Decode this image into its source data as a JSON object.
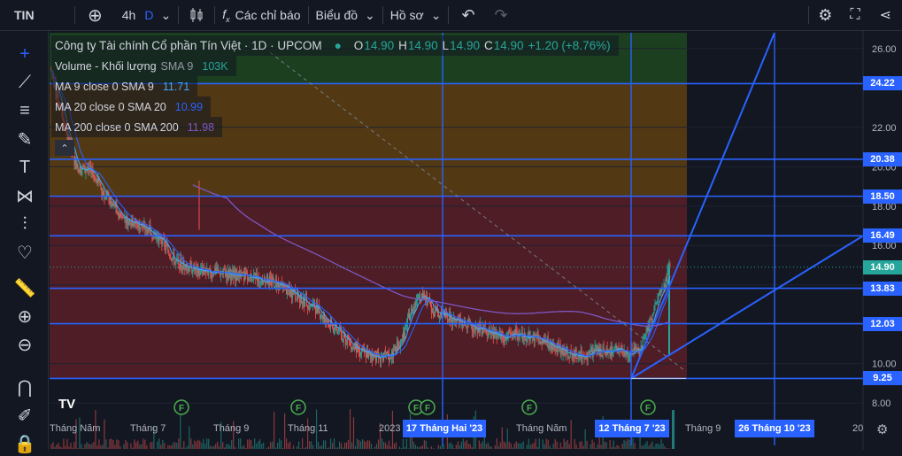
{
  "topbar": {
    "ticker": "TIN",
    "interval": "4h",
    "chart_style": "D",
    "indicators_label": "Các chỉ báo",
    "layout_label": "Biểu đồ",
    "profile_label": "Hồ sơ"
  },
  "legend": {
    "title": "Công ty Tài chính Cổ phần Tín Việt · 1D · UPCOM",
    "ohlc": {
      "o_label": "O",
      "o": "14.90",
      "h_label": "H",
      "h": "14.90",
      "l_label": "L",
      "l": "14.90",
      "c_label": "C",
      "c": "14.90",
      "change": "+1.20 (+8.76%)"
    },
    "volume": {
      "label": "Volume - Khối lượng",
      "params": "SMA 9",
      "value": "103K"
    },
    "ma9": {
      "label": "MA 9 close 0 SMA 9",
      "value": "11.71"
    },
    "ma20": {
      "label": "MA 20 close 0 SMA 20",
      "value": "10.99"
    },
    "ma200": {
      "label": "MA 200 close 0 SMA 200",
      "value": "11.98"
    }
  },
  "colors": {
    "background": "#131722",
    "up": "#26a69a",
    "down": "#ef5350",
    "ma9": "#42a5f5",
    "ma20": "#2962ff",
    "ma200": "#7e57c2",
    "level_line": "#2962ff",
    "zone_green": "#1e4620",
    "zone_orange": "#5a3d12",
    "zone_red": "#5a1f27"
  },
  "chart_data": {
    "type": "candlestick",
    "y_range": [
      7.2,
      26.8
    ],
    "y_ticks": [
      "26.00",
      "22.00",
      "20.00",
      "18.00",
      "16.00",
      "14.00",
      "12.00",
      "10.00",
      "8.00"
    ],
    "price_levels": [
      {
        "label": "24.22",
        "value": 24.22
      },
      {
        "label": "20.38",
        "value": 20.38
      },
      {
        "label": "18.50",
        "value": 18.5
      },
      {
        "label": "16.49",
        "value": 16.49
      },
      {
        "label": "13.83",
        "value": 13.83
      },
      {
        "label": "12.03",
        "value": 12.03
      },
      {
        "label": "9.25",
        "value": 9.25
      }
    ],
    "last_price": "14.90",
    "x_labels": [
      "Tháng Năm",
      "Tháng 7",
      "Tháng 9",
      "Tháng 11",
      "2023",
      "Tháng Năm",
      "Tháng 9",
      "20"
    ],
    "x_highlights": [
      "17 Tháng Hai '23",
      "12 Tháng 7 '23",
      "26 Tháng 10 '23"
    ],
    "price_path": [
      [
        0,
        24.9
      ],
      [
        18,
        21.6
      ],
      [
        30,
        19.8
      ],
      [
        45,
        19.9
      ],
      [
        60,
        18.6
      ],
      [
        80,
        17.4
      ],
      [
        95,
        17.2
      ],
      [
        110,
        16.8
      ],
      [
        125,
        16.2
      ],
      [
        140,
        15.2
      ],
      [
        160,
        14.8
      ],
      [
        185,
        14.6
      ],
      [
        210,
        14.5
      ],
      [
        235,
        14.3
      ],
      [
        255,
        14.1
      ],
      [
        275,
        13.5
      ],
      [
        300,
        12.8
      ],
      [
        320,
        11.8
      ],
      [
        335,
        11.2
      ],
      [
        350,
        10.6
      ],
      [
        365,
        10.4
      ],
      [
        380,
        10.3
      ],
      [
        395,
        11.0
      ],
      [
        405,
        12.4
      ],
      [
        415,
        13.6
      ],
      [
        425,
        13.2
      ],
      [
        435,
        12.6
      ],
      [
        450,
        12.3
      ],
      [
        465,
        12.0
      ],
      [
        480,
        11.9
      ],
      [
        495,
        11.6
      ],
      [
        510,
        11.3
      ],
      [
        525,
        11.5
      ],
      [
        540,
        11.4
      ],
      [
        555,
        11.2
      ],
      [
        570,
        10.9
      ],
      [
        585,
        10.5
      ],
      [
        600,
        10.4
      ],
      [
        615,
        10.7
      ],
      [
        625,
        10.6
      ],
      [
        640,
        10.7
      ],
      [
        655,
        10.5
      ],
      [
        665,
        10.6
      ],
      [
        675,
        11.8
      ],
      [
        690,
        13.7
      ],
      [
        700,
        14.9
      ]
    ],
    "events": [
      "F",
      "F",
      "F",
      "F",
      "F",
      "F"
    ]
  }
}
